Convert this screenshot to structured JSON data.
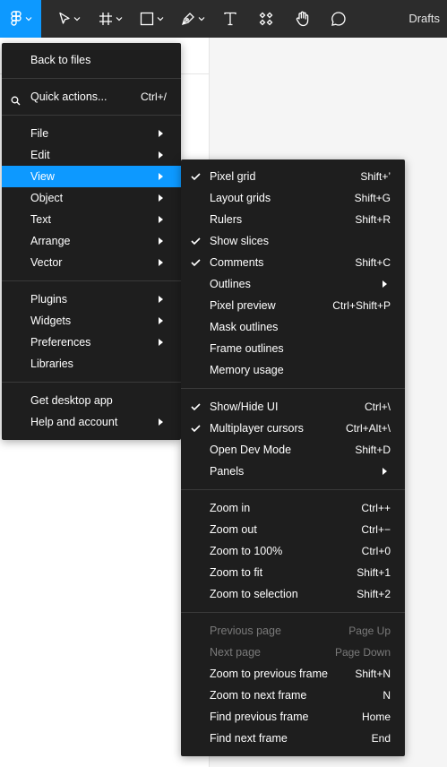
{
  "toolbar": {
    "drafts_label": "Drafts",
    "tools": [
      {
        "icon": "figma-logo-icon",
        "active": true
      },
      {
        "icon": "move-icon"
      },
      {
        "icon": "frame-icon"
      },
      {
        "icon": "rectangle-icon"
      },
      {
        "icon": "pen-icon"
      },
      {
        "icon": "text-icon"
      },
      {
        "icon": "resources-icon"
      },
      {
        "icon": "hand-icon"
      },
      {
        "icon": "comment-icon"
      }
    ]
  },
  "main_menu": {
    "back_to_files": "Back to files",
    "quick_actions": {
      "label": "Quick actions...",
      "shortcut": "Ctrl+/"
    },
    "file": "File",
    "edit": "Edit",
    "view": "View",
    "object": "Object",
    "text": "Text",
    "arrange": "Arrange",
    "vector": "Vector",
    "plugins": "Plugins",
    "widgets": "Widgets",
    "preferences": "Preferences",
    "libraries": "Libraries",
    "get_desktop_app": "Get desktop app",
    "help_and_account": "Help and account"
  },
  "view_menu": {
    "pixel_grid": {
      "label": "Pixel grid",
      "shortcut": "Shift+’",
      "checked": true
    },
    "layout_grids": {
      "label": "Layout grids",
      "shortcut": "Shift+G"
    },
    "rulers": {
      "label": "Rulers",
      "shortcut": "Shift+R"
    },
    "show_slices": {
      "label": "Show slices",
      "checked": true
    },
    "comments": {
      "label": "Comments",
      "shortcut": "Shift+C",
      "checked": true
    },
    "outlines": {
      "label": "Outlines"
    },
    "pixel_preview": {
      "label": "Pixel preview",
      "shortcut": "Ctrl+Shift+P"
    },
    "mask_outlines": {
      "label": "Mask outlines"
    },
    "frame_outlines": {
      "label": "Frame outlines"
    },
    "memory_usage": {
      "label": "Memory usage"
    },
    "show_hide_ui": {
      "label": "Show/Hide UI",
      "shortcut": "Ctrl+\\",
      "checked": true
    },
    "multiplayer_cursors": {
      "label": "Multiplayer cursors",
      "shortcut": "Ctrl+Alt+\\",
      "checked": true
    },
    "open_dev_mode": {
      "label": "Open Dev Mode",
      "shortcut": "Shift+D"
    },
    "panels": {
      "label": "Panels"
    },
    "zoom_in": {
      "label": "Zoom in",
      "shortcut": "Ctrl++"
    },
    "zoom_out": {
      "label": "Zoom out",
      "shortcut": "Ctrl+−"
    },
    "zoom_100": {
      "label": "Zoom to 100%",
      "shortcut": "Ctrl+0"
    },
    "zoom_fit": {
      "label": "Zoom to fit",
      "shortcut": "Shift+1"
    },
    "zoom_selection": {
      "label": "Zoom to selection",
      "shortcut": "Shift+2"
    },
    "previous_page": {
      "label": "Previous page",
      "shortcut": "Page Up",
      "disabled": true
    },
    "next_page": {
      "label": "Next page",
      "shortcut": "Page Down",
      "disabled": true
    },
    "zoom_prev_frame": {
      "label": "Zoom to previous frame",
      "shortcut": "Shift+N"
    },
    "zoom_next_frame": {
      "label": "Zoom to next frame",
      "shortcut": "N"
    },
    "find_prev_frame": {
      "label": "Find previous frame",
      "shortcut": "Home"
    },
    "find_next_frame": {
      "label": "Find next frame",
      "shortcut": "End"
    }
  },
  "colors": {
    "toolbar_bg": "#2c2c2c",
    "menu_bg": "#1e1e1e",
    "accent": "#0d99ff",
    "disabled_text": "#7a7a7a"
  }
}
